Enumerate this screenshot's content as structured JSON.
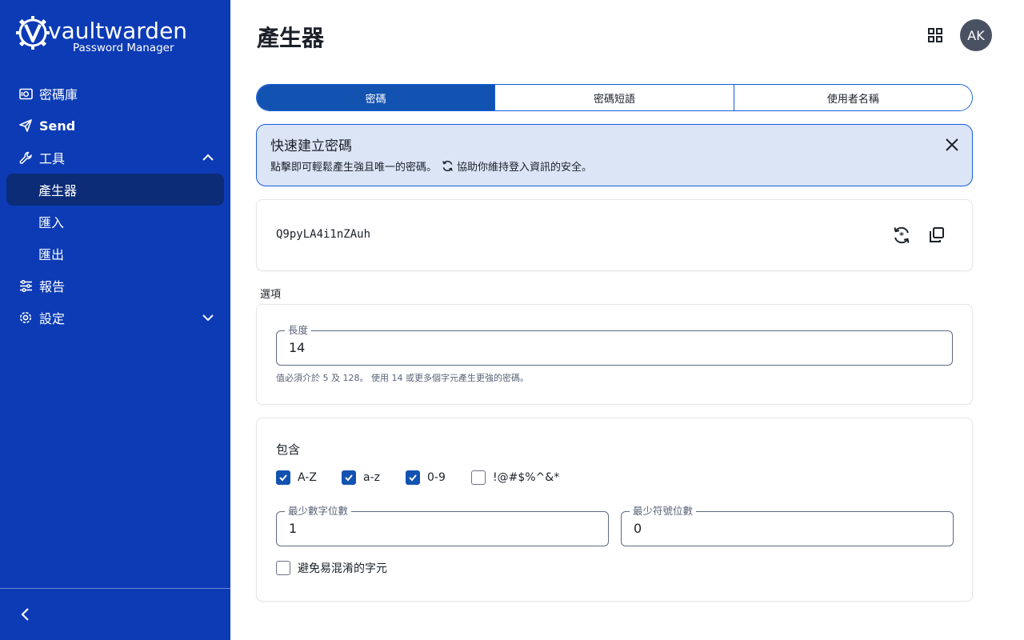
{
  "brand": {
    "name": "vaultwarden",
    "subtitle": "Password Manager",
    "logo_icon": "gear-v-logo"
  },
  "sidebar": {
    "items": [
      {
        "label": "密碼庫",
        "icon": "vault-icon"
      },
      {
        "label": "Send",
        "icon": "send-icon"
      },
      {
        "label": "工具",
        "icon": "wrench-icon",
        "expanded": true
      },
      {
        "label": "報告",
        "icon": "sliders-icon"
      },
      {
        "label": "設定",
        "icon": "gear-icon",
        "expanded": false
      }
    ],
    "tools_sub": [
      {
        "label": "產生器",
        "active": true
      },
      {
        "label": "匯入",
        "active": false
      },
      {
        "label": "匯出",
        "active": false
      }
    ]
  },
  "header": {
    "title": "產生器",
    "avatar_initials": "AK"
  },
  "tabs": [
    {
      "label": "密碼",
      "active": true
    },
    {
      "label": "密碼短語",
      "active": false
    },
    {
      "label": "使用者名稱",
      "active": false
    }
  ],
  "callout": {
    "title": "快速建立密碼",
    "text_before": "點擊即可輕鬆產生強且唯一的密碼。",
    "text_after": "協助你維持登入資訊的安全。"
  },
  "generated_password": "Q9pyLA4i1nZAuh",
  "options": {
    "section_label": "選項",
    "length_label": "長度",
    "length_value": "14",
    "length_hint": "值必須介於 5 及 128。 使用 14 或更多個字元產生更強的密碼。"
  },
  "include": {
    "title": "包含",
    "checkboxes": [
      {
        "label": "A-Z",
        "checked": true
      },
      {
        "label": "a-z",
        "checked": true
      },
      {
        "label": "0-9",
        "checked": true
      },
      {
        "label": "!@#$%^&*",
        "checked": false
      }
    ],
    "min_numbers_label": "最少數字位數",
    "min_numbers_value": "1",
    "min_special_label": "最少符號位數",
    "min_special_value": "0",
    "avoid_ambiguous_label": "避免易混淆的字元",
    "avoid_ambiguous_checked": false
  },
  "colors": {
    "sidebar_bg": "#0c3bb5",
    "sidebar_active": "#0c2c78",
    "accent": "#1252b0",
    "callout_bg": "#dbe5f6"
  }
}
